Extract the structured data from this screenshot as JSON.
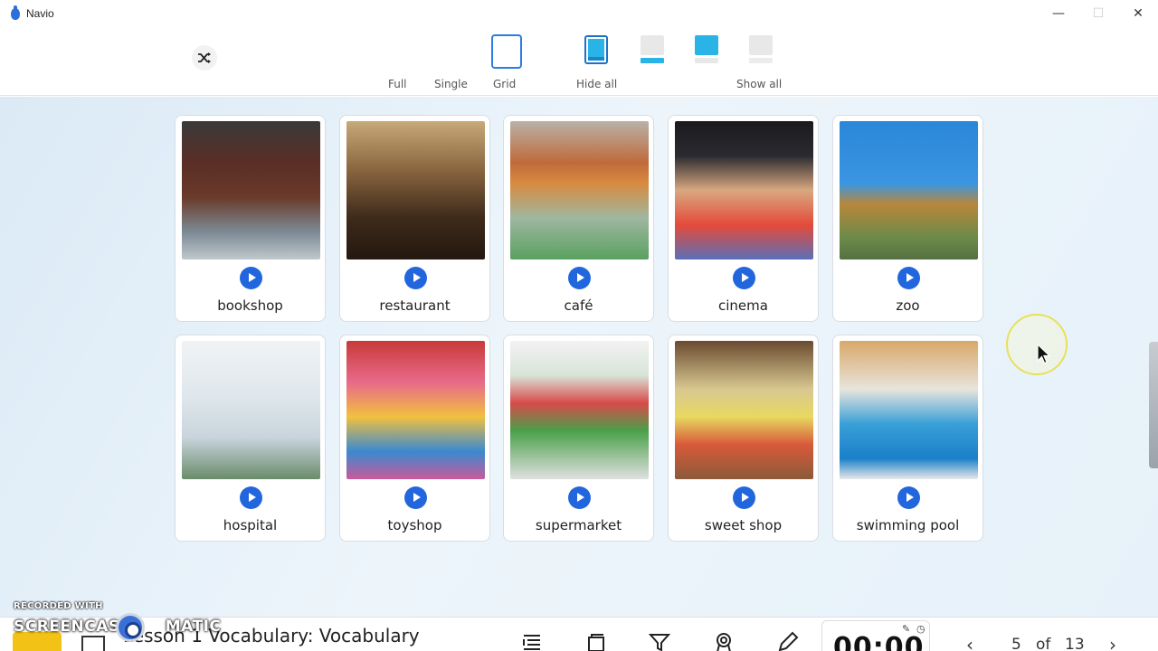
{
  "window": {
    "title": "Navio",
    "minimize": "—",
    "maximize": "☐",
    "close": "✕"
  },
  "toolbar": {
    "shuffle_icon": "shuffle-icon",
    "modes": [
      "Full",
      "Single",
      "Grid"
    ],
    "hide_all": "Hide all",
    "show_all": "Show all",
    "accent": "#2ab3e6"
  },
  "cards": [
    {
      "label": "bookshop"
    },
    {
      "label": "restaurant"
    },
    {
      "label": "café"
    },
    {
      "label": "cinema"
    },
    {
      "label": "zoo"
    },
    {
      "label": "hospital"
    },
    {
      "label": "toyshop"
    },
    {
      "label": "supermarket"
    },
    {
      "label": "sweet shop"
    },
    {
      "label": "swimming pool"
    }
  ],
  "bottombar": {
    "lesson_title": "Lesson 1 Vocabulary: Vocabulary",
    "timer": "00:00",
    "page_current": "5",
    "page_of": "of",
    "page_total": "13",
    "prev": "‹",
    "next": "›"
  },
  "watermark": {
    "recorded_with": "RECORDED WITH",
    "brand": "SCREENCAST",
    "brand_suffix": "MATIC"
  }
}
